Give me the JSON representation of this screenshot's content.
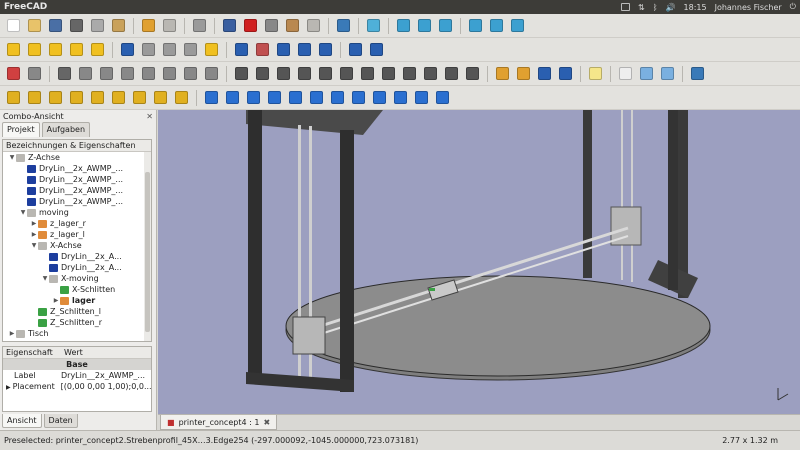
{
  "window": {
    "title": "FreeCAD"
  },
  "topbar": {
    "clock": "18:15",
    "user": "Johannes Fischer"
  },
  "toolbar_rows": [
    [
      {
        "icon": "new-document-icon",
        "color": "#ffffff"
      },
      {
        "icon": "open-icon",
        "color": "#e8c36a"
      },
      {
        "icon": "save-icon",
        "color": "#4a6fa5"
      },
      {
        "icon": "cut-icon",
        "color": "#666666"
      },
      {
        "icon": "copy-icon",
        "color": "#aaaaaa"
      },
      {
        "icon": "paste-icon",
        "color": "#c9a15a"
      },
      "sep",
      {
        "icon": "undo-icon",
        "color": "#e0a030"
      },
      {
        "icon": "redo-icon",
        "color": "#b9b7b2"
      },
      "sep",
      {
        "icon": "refresh-icon",
        "color": "#9a9a9a"
      },
      "sep",
      {
        "icon": "whats-this-icon",
        "color": "#3a5fa0"
      },
      {
        "icon": "record-macro-icon",
        "color": "#d02020"
      },
      {
        "icon": "stop-macro-icon",
        "color": "#888888"
      },
      {
        "icon": "edit-macro-icon",
        "color": "#b98850"
      },
      {
        "icon": "run-macro-icon",
        "color": "#b9b7b2"
      },
      "sep",
      {
        "icon": "fit-all-icon",
        "color": "#3a7ab8"
      },
      "sep",
      {
        "icon": "view-axonometric-icon",
        "color": "#4fb0d8"
      },
      "sep",
      {
        "icon": "view-front-icon",
        "color": "#3ca0d0"
      },
      {
        "icon": "view-top-icon",
        "color": "#3ca0d0"
      },
      {
        "icon": "view-right-icon",
        "color": "#3ca0d0"
      },
      "sep",
      {
        "icon": "view-rear-icon",
        "color": "#3ca0d0"
      },
      {
        "icon": "view-bottom-icon",
        "color": "#3ca0d0"
      },
      {
        "icon": "view-left-icon",
        "color": "#3ca0d0"
      }
    ],
    [
      {
        "icon": "part-box-icon",
        "color": "#f0c020"
      },
      {
        "icon": "part-cylinder-icon",
        "color": "#f0c020"
      },
      {
        "icon": "part-sphere-icon",
        "color": "#f0c020"
      },
      {
        "icon": "part-cone-icon",
        "color": "#f0c020"
      },
      {
        "icon": "part-torus-icon",
        "color": "#f0c020"
      },
      "sep",
      {
        "icon": "boolean-icon",
        "color": "#2a5fb0"
      },
      {
        "icon": "cut-shape-icon",
        "color": "#9a9a9a"
      },
      {
        "icon": "fuse-icon",
        "color": "#9a9a9a"
      },
      {
        "icon": "common-icon",
        "color": "#9a9a9a"
      },
      {
        "icon": "section-icon",
        "color": "#f0c020"
      },
      "sep",
      {
        "icon": "extrude-icon",
        "color": "#2a5fb0"
      },
      {
        "icon": "revolve-icon",
        "color": "#c05050"
      },
      {
        "icon": "mirror-icon",
        "color": "#2a5fb0"
      },
      {
        "icon": "fillet-icon",
        "color": "#2a5fb0"
      },
      {
        "icon": "chamfer-icon",
        "color": "#2a5fb0"
      },
      "sep",
      {
        "icon": "loft-icon",
        "color": "#2a5fb0"
      },
      {
        "icon": "sweep-icon",
        "color": "#2a5fb0"
      }
    ],
    [
      {
        "icon": "sketch-icon",
        "color": "#d04040"
      },
      {
        "icon": "sketch-map-icon",
        "color": "#888888"
      },
      "sep",
      {
        "icon": "point-icon",
        "color": "#666666"
      },
      {
        "icon": "circle-tool-icon",
        "color": "#888888"
      },
      {
        "icon": "line-tool-icon",
        "color": "#888888"
      },
      {
        "icon": "arc-tool-icon",
        "color": "#888888"
      },
      {
        "icon": "rectangle-tool-icon",
        "color": "#888888"
      },
      {
        "icon": "polyline-tool-icon",
        "color": "#888888"
      },
      {
        "icon": "trim-icon",
        "color": "#888888"
      },
      {
        "icon": "external-icon",
        "color": "#888888"
      },
      "sep",
      {
        "icon": "lock-constraint-icon",
        "color": "#555555"
      },
      {
        "icon": "point-constraint-icon",
        "color": "#555555"
      },
      {
        "icon": "corner-constraint-icon",
        "color": "#555555"
      },
      {
        "icon": "horizontal-constraint-icon",
        "color": "#555555"
      },
      {
        "icon": "vertical-constraint-icon",
        "color": "#555555"
      },
      {
        "icon": "distance-constraint-icon",
        "color": "#555555"
      },
      {
        "icon": "radius-constraint-icon",
        "color": "#555555"
      },
      {
        "icon": "angle-constraint-icon",
        "color": "#555555"
      },
      {
        "icon": "slope-constraint-icon",
        "color": "#555555"
      },
      {
        "icon": "parallel-constraint-icon",
        "color": "#555555"
      },
      {
        "icon": "equal-constraint-icon",
        "color": "#555555"
      },
      {
        "icon": "symmetric-constraint-icon",
        "color": "#555555"
      },
      "sep",
      {
        "icon": "pad-icon",
        "color": "#e0a030"
      },
      {
        "icon": "pocket-icon",
        "color": "#e0a030"
      },
      {
        "icon": "hole-icon",
        "color": "#2a5fb0"
      },
      {
        "icon": "groove-icon",
        "color": "#2a5fb0"
      },
      "sep",
      {
        "icon": "note-icon",
        "color": "#f5e68a"
      },
      "sep",
      {
        "icon": "drawing-a3-icon",
        "color": "#eeeeee"
      },
      {
        "icon": "drawing-view-icon",
        "color": "#7ab0e0"
      },
      {
        "icon": "drawing-annotation-icon",
        "color": "#7ab0e0"
      },
      "sep",
      {
        "icon": "web-icon",
        "color": "#3a7ab8"
      }
    ],
    [
      {
        "icon": "draft-line-icon",
        "color": "#e0b020"
      },
      {
        "icon": "draft-wire-icon",
        "color": "#e0b020"
      },
      {
        "icon": "draft-circle-icon",
        "color": "#e0b020"
      },
      {
        "icon": "draft-arc-icon",
        "color": "#e0b020"
      },
      {
        "icon": "draft-rectangle-icon",
        "color": "#e0b020"
      },
      {
        "icon": "draft-polygon-icon",
        "color": "#e0b020"
      },
      {
        "icon": "draft-bspline-icon",
        "color": "#e0b020"
      },
      {
        "icon": "draft-text-icon",
        "color": "#e0b020"
      },
      {
        "icon": "draft-dimension-icon",
        "color": "#e0b020"
      },
      "sep",
      {
        "icon": "move-icon",
        "color": "#2a6fd0"
      },
      {
        "icon": "rotate-icon",
        "color": "#2a6fd0"
      },
      {
        "icon": "offset-icon",
        "color": "#2a6fd0"
      },
      {
        "icon": "upgrade-icon",
        "color": "#2a6fd0"
      },
      {
        "icon": "downgrade-icon",
        "color": "#2a6fd0"
      },
      {
        "icon": "scale-icon",
        "color": "#2a6fd0"
      },
      {
        "icon": "draft-edit-icon",
        "color": "#2a6fd0"
      },
      {
        "icon": "wire-to-bspline-icon",
        "color": "#2a6fd0"
      },
      {
        "icon": "add-point-icon",
        "color": "#2a6fd0"
      },
      {
        "icon": "del-point-icon",
        "color": "#2a6fd0"
      },
      {
        "icon": "shape-to-2d-icon",
        "color": "#2a6fd0"
      },
      {
        "icon": "draft-to-sketch-icon",
        "color": "#2a6fd0"
      }
    ]
  ],
  "combo": {
    "title": "Combo-Ansicht",
    "tabs": [
      "Projekt",
      "Aufgaben"
    ],
    "bottom_tabs": [
      "Ansicht",
      "Daten"
    ],
    "tree_header": "Bezeichnungen & Eigenschaften",
    "tree": [
      {
        "label": "Z-Achse",
        "indent": 1,
        "arrow": "▼",
        "icon": "folder"
      },
      {
        "label": "DryLin__2x_AWMP_...",
        "indent": 2,
        "arrow": "",
        "icon": "blue"
      },
      {
        "label": "DryLin__2x_AWMP_...",
        "indent": 2,
        "arrow": "",
        "icon": "blue"
      },
      {
        "label": "DryLin__2x_AWMP_...",
        "indent": 2,
        "arrow": "",
        "icon": "blue"
      },
      {
        "label": "DryLin__2x_AWMP_...",
        "indent": 2,
        "arrow": "",
        "icon": "blue"
      },
      {
        "label": "moving",
        "indent": 2,
        "arrow": "▼",
        "icon": "folder"
      },
      {
        "label": "z_lager_r",
        "indent": 3,
        "arrow": "▶",
        "icon": "orange"
      },
      {
        "label": "z_lager_l",
        "indent": 3,
        "arrow": "▶",
        "icon": "orange"
      },
      {
        "label": "X-Achse",
        "indent": 3,
        "arrow": "▼",
        "icon": "folder"
      },
      {
        "label": "DryLin__2x_A...",
        "indent": 4,
        "arrow": "",
        "icon": "blue"
      },
      {
        "label": "DryLin__2x_A...",
        "indent": 4,
        "arrow": "",
        "icon": "blue"
      },
      {
        "label": "X-moving",
        "indent": 4,
        "arrow": "▼",
        "icon": "folder"
      },
      {
        "label": "X-Schlitten",
        "indent": 5,
        "arrow": "",
        "icon": "green"
      },
      {
        "label": "lager",
        "indent": 5,
        "arrow": "▶",
        "icon": "orange",
        "bold": true
      },
      {
        "label": "Z_Schlitten_l",
        "indent": 3,
        "arrow": "",
        "icon": "green"
      },
      {
        "label": "Z_Schlitten_r",
        "indent": 3,
        "arrow": "",
        "icon": "green"
      },
      {
        "label": "Tisch",
        "indent": 1,
        "arrow": "▶",
        "icon": "folder"
      }
    ],
    "props": {
      "col_property": "Eigenschaft",
      "col_value": "Wert",
      "group": "Base",
      "rows": [
        {
          "key": "Label",
          "value": "DryLin__2x_AWMP_...",
          "arrow": ""
        },
        {
          "key": "Placement",
          "value": "[(0,00 0,00 1,00);0,0...",
          "arrow": "▶"
        }
      ]
    }
  },
  "document_tab": {
    "label": "printer_concept4 : 1",
    "close": "✖"
  },
  "status": {
    "message": "Preselected: printer_concept2.Strebenprofil_45X…3.Edge254 (-297.000092,-1045.000000,723.073181)",
    "dimensions": "2.77 x 1.32 m"
  },
  "colors": {
    "viewport_background": "#9c9fc0",
    "frame": "#3a3a3a",
    "table": "#8a8a8a"
  }
}
